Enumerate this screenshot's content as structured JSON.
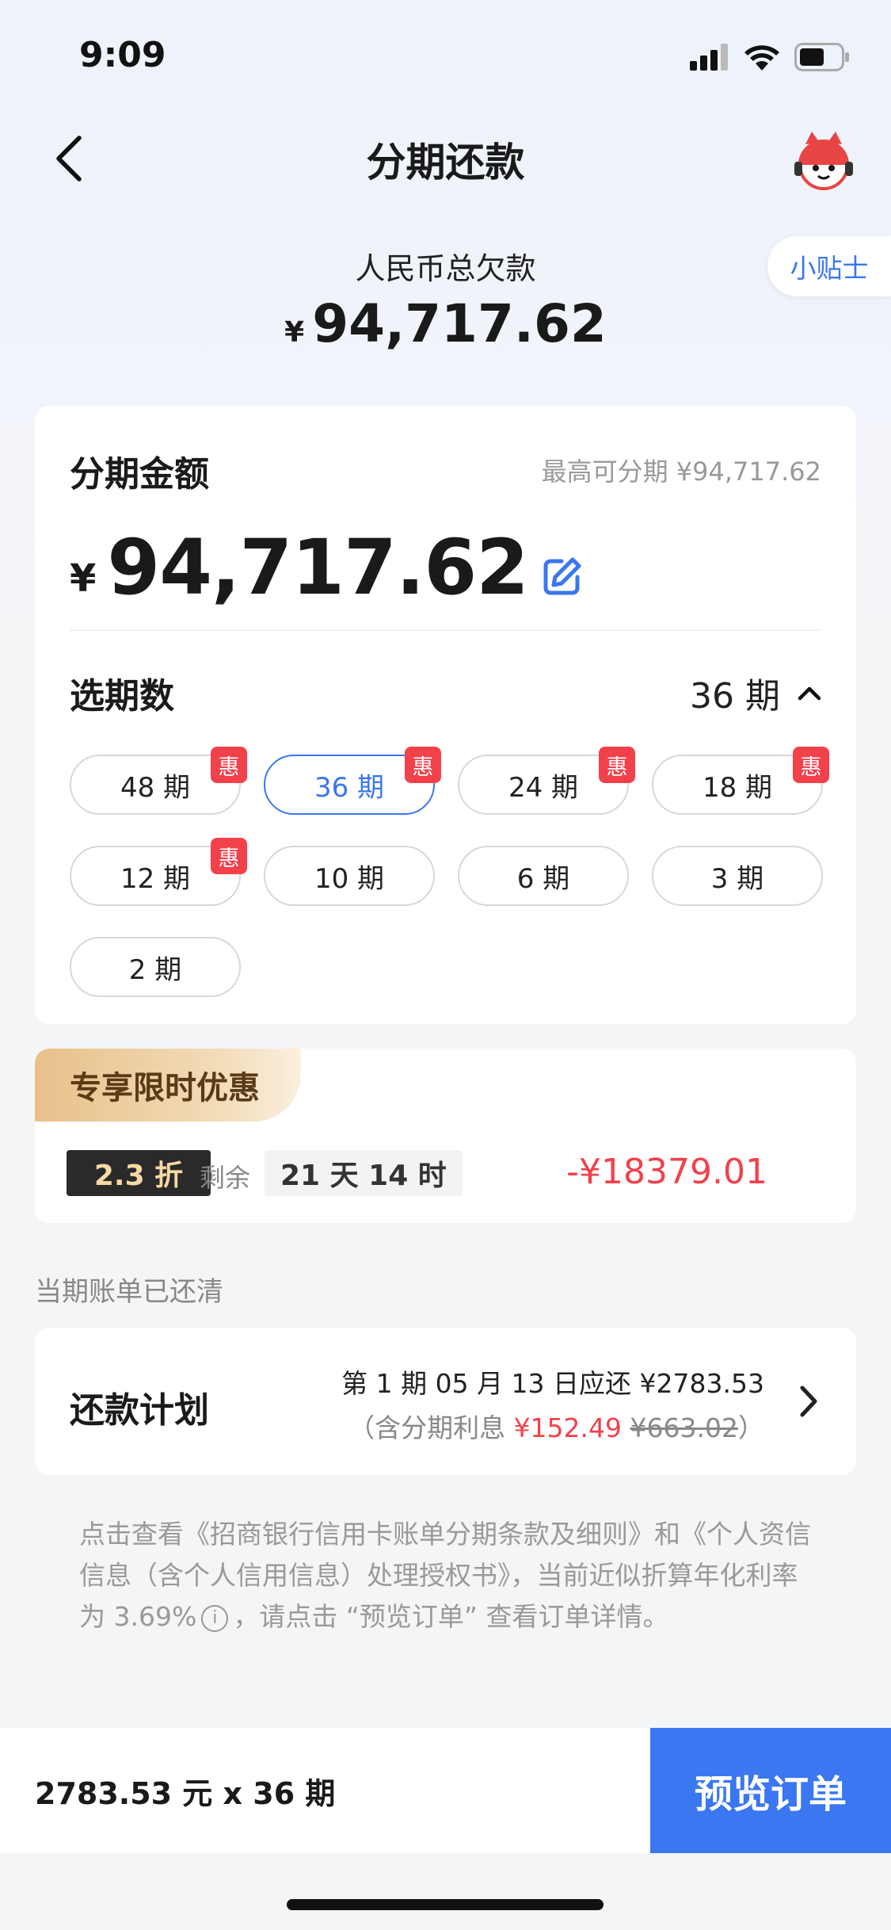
{
  "status_bar": {
    "time": "9:09"
  },
  "nav": {
    "title": "分期还款"
  },
  "tips_label": "小贴士",
  "summary": {
    "label": "人民币总欠款",
    "currency": "¥",
    "amount": "94,717.62"
  },
  "installment": {
    "amount_label": "分期金额",
    "max_label": "最高可分期 ¥94,717.62",
    "currency": "¥",
    "amount": "94,717.62",
    "periods_label": "选期数",
    "selected_period": "36 期",
    "discount_badge": "惠",
    "options": [
      {
        "label": "48 期",
        "discount": true
      },
      {
        "label": "36 期",
        "discount": true,
        "active": true
      },
      {
        "label": "24 期",
        "discount": true
      },
      {
        "label": "18 期",
        "discount": true
      },
      {
        "label": "12 期",
        "discount": true
      },
      {
        "label": "10 期",
        "discount": false
      },
      {
        "label": "6 期",
        "discount": false
      },
      {
        "label": "3 期",
        "discount": false
      },
      {
        "label": "2 期",
        "discount": false
      }
    ]
  },
  "promo": {
    "tag": "专享限时优惠",
    "discount": "2.3 折",
    "remaining_label": "剩余",
    "remaining_time": "21 天 14 时",
    "saving": "-¥18379.01"
  },
  "bill_status": "当期账单已还清",
  "plan": {
    "label": "还款计划",
    "line1": "第 1 期 05 月 13 日应还 ¥2783.53",
    "line2_prefix": "（含分期利息 ",
    "interest": "¥152.49",
    "original_interest": "¥663.02",
    "line2_suffix": "）"
  },
  "terms": {
    "part1": "点击查看《招商银行信用卡账单分期条款及细则》和《个人资信信息（含个人信用信息）处理授权书》，当前近似折算年化利率为 3.69%",
    "info_glyph": "i",
    "part2": "，请点击 “预览订单” 查看订单详情。"
  },
  "bottom": {
    "summary": "2783.53 元 x 36 期",
    "button": "预览订单"
  },
  "colors": {
    "accent": "#3a77f0",
    "red": "#f2414b",
    "gold": "#e8c08a"
  }
}
